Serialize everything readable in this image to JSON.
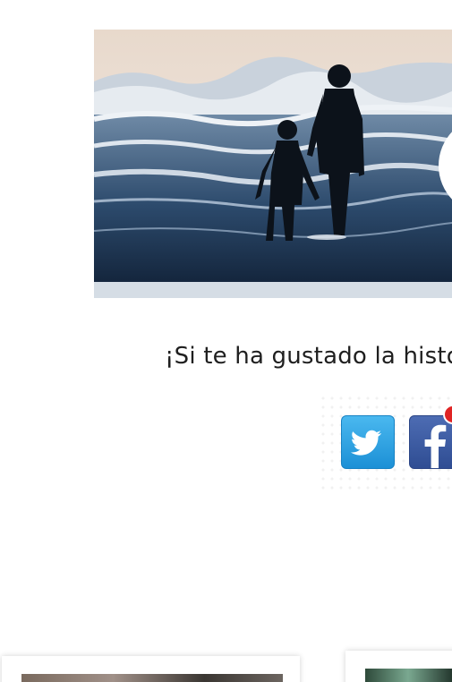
{
  "post": {
    "caption": "¡Si te ha gustado la histo",
    "hero_image_alt": "father-and-son-on-beach-photo"
  },
  "share": {
    "twitter_icon": "twitter-bird-icon",
    "facebook_icon": "facebook-f-icon"
  },
  "related": {
    "cards": [
      "related-post-card",
      "related-post-card"
    ]
  }
}
